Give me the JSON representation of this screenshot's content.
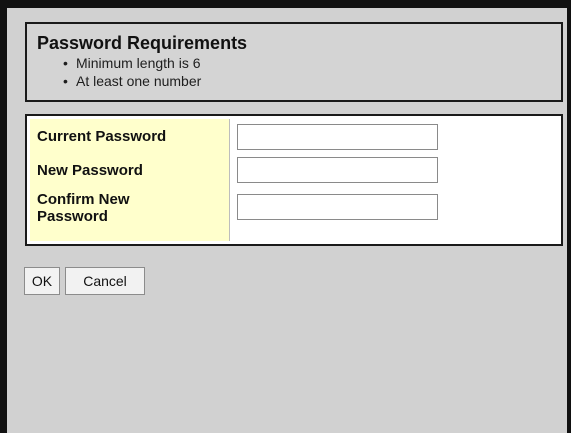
{
  "requirements": {
    "title": "Password Requirements",
    "bullet": "•",
    "items": [
      "Minimum length is 6",
      "At least one number"
    ]
  },
  "form": {
    "current_password_label": "Current Password",
    "new_password_label": "New Password",
    "confirm_password_label_line1": "Confirm New",
    "confirm_password_label_line2": "Password",
    "current_password_value": "",
    "new_password_value": "",
    "confirm_password_value": ""
  },
  "buttons": {
    "ok": "OK",
    "cancel": "Cancel"
  },
  "colors": {
    "dialog_background": "#d1d1d1",
    "label_column_background": "#ffffcc",
    "frame_border": "#111111"
  }
}
